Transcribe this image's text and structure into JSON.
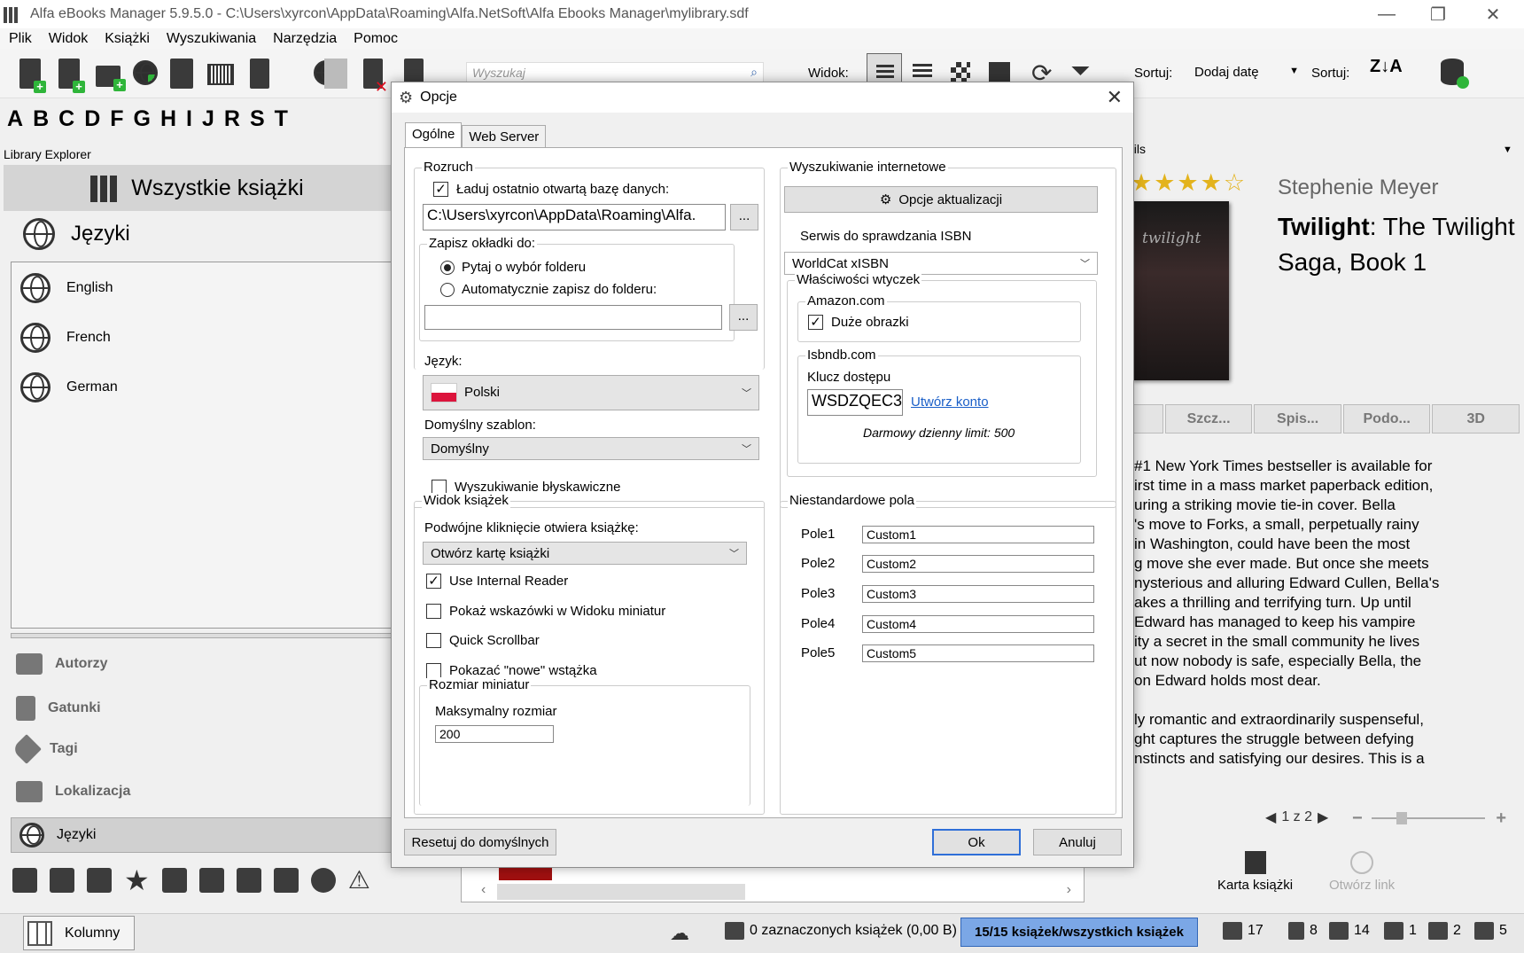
{
  "window": {
    "title": "Alfa eBooks Manager 5.9.5.0 - C:\\Users\\xyrcon\\AppData\\Roaming\\Alfa.NetSoft\\Alfa Ebooks Manager\\mylibrary.sdf",
    "minimize": "—",
    "restore": "❐",
    "close": "✕"
  },
  "menu": [
    "Plik",
    "Widok",
    "Książki",
    "Wyszukiwania",
    "Narzędzia",
    "Pomoc"
  ],
  "toolbar": {
    "search_placeholder": "Wyszukaj",
    "view_label": "Widok:",
    "sort_label": "Sortuj:",
    "sort_value": "Dodaj datę",
    "sort_label2": "Sortuj:",
    "sort_az": "Z↓A"
  },
  "alphabet": [
    "A",
    "B",
    "C",
    "D",
    "F",
    "G",
    "H",
    "I",
    "J",
    "R",
    "S",
    "T"
  ],
  "library_explorer": {
    "title": "Library Explorer",
    "all_books": "Wszystkie książki",
    "group": "Języki",
    "languages": [
      "English",
      "French",
      "German"
    ],
    "nav": [
      "Autorzy",
      "Gatunki",
      "Tagi",
      "Lokalizacja",
      "Języki"
    ]
  },
  "details": {
    "title": "ails",
    "author": "Stephenie Meyer",
    "book_title_bold": "Twilight",
    "book_title_rest": ": The Twilight Saga, Book 1",
    "rating": "★★★★☆",
    "cover_text": "twilight",
    "tabs": [
      "",
      "Szcz...",
      "Spis...",
      "Podo...",
      "3D"
    ],
    "description": [
      "#1 New York Times bestseller is available for",
      "irst time in a mass market paperback edition,",
      "uring a striking movie tie-in cover. Bella",
      "'s move to Forks, a small, perpetually rainy",
      " in Washington, could have been the most",
      "g move she ever made. But once she meets",
      "nysterious and alluring Edward Cullen, Bella's",
      "akes a thrilling and terrifying turn. Up until",
      " Edward has managed to keep his vampire",
      "ity a secret in the small community he lives",
      "ut now nobody is safe, especially Bella, the",
      "on Edward holds most dear."
    ],
    "description2": [
      "ly romantic and extraordinarily suspenseful,",
      "ght captures the struggle between defying",
      "nstincts and satisfying our desires. This is a"
    ],
    "pager": "1 z 2",
    "card_btn": "Karta książki",
    "open_link": "Otwórz link"
  },
  "status": {
    "columns": "Kolumny",
    "selected": "0 zaznaczonych książek (0,00 B)",
    "count": "15/15 książek/wszystkich książek",
    "c1": "17",
    "c2": "8",
    "c3": "14",
    "c4": "1",
    "c5": "2",
    "c6": "5"
  },
  "dialog": {
    "title": "Opcje",
    "tabs": [
      "Ogólne",
      "Web Server"
    ],
    "startup": {
      "title": "Rozruch",
      "load_last": "Ładuj ostatnio otwartą bazę danych:",
      "db_path": "C:\\Users\\xyrcon\\AppData\\Roaming\\Alfa.",
      "browse": "...",
      "covers_title": "Zapisz okładki do:",
      "ask_folder": "Pytaj o wybór folderu",
      "auto_folder": "Automatycznie zapisz do folderu:",
      "folder_value": ""
    },
    "language_label": "Język:",
    "language_value": "Polski",
    "template_label": "Domyślny szablon:",
    "template_value": "Domyślny",
    "instant_search": "Wyszukiwanie błyskawiczne",
    "internet": {
      "title": "Wyszukiwanie internetowe",
      "update_btn": "Opcje aktualizacji",
      "isbn_label": "Serwis do sprawdzania ISBN",
      "isbn_value": "WorldCat xISBN",
      "plugins_title": "Właściwości wtyczek",
      "amazon": "Amazon.com",
      "big_images": "Duże obrazki",
      "isbndb": "Isbndb.com",
      "key_label": "Klucz dostępu",
      "key_value": "WSDZQEC3",
      "create_account": "Utwórz konto",
      "limit": "Darmowy dzienny limit: 500"
    },
    "bookview": {
      "title": "Widok książek",
      "dbl_label": "Podwójne kliknięcie otwiera książkę:",
      "dbl_value": "Otwórz kartę książki",
      "internal_reader": "Use Internal Reader",
      "thumb_hints": "Pokaż wskazówki w Widoku miniatur",
      "quick_scroll": "Quick Scrollbar",
      "new_ribbon": "Pokazać \"nowe\" wstążka",
      "thumb_title": "Rozmiar miniatur",
      "max_size": "Maksymalny rozmiar",
      "max_value": "200"
    },
    "custom": {
      "title": "Niestandardowe pola",
      "fields": [
        {
          "label": "Pole1",
          "value": "Custom1"
        },
        {
          "label": "Pole2",
          "value": "Custom2"
        },
        {
          "label": "Pole3",
          "value": "Custom3"
        },
        {
          "label": "Pole4",
          "value": "Custom4"
        },
        {
          "label": "Pole5",
          "value": "Custom5"
        }
      ]
    },
    "reset": "Resetuj do domyślnych",
    "ok": "Ok",
    "cancel": "Anuluj"
  }
}
